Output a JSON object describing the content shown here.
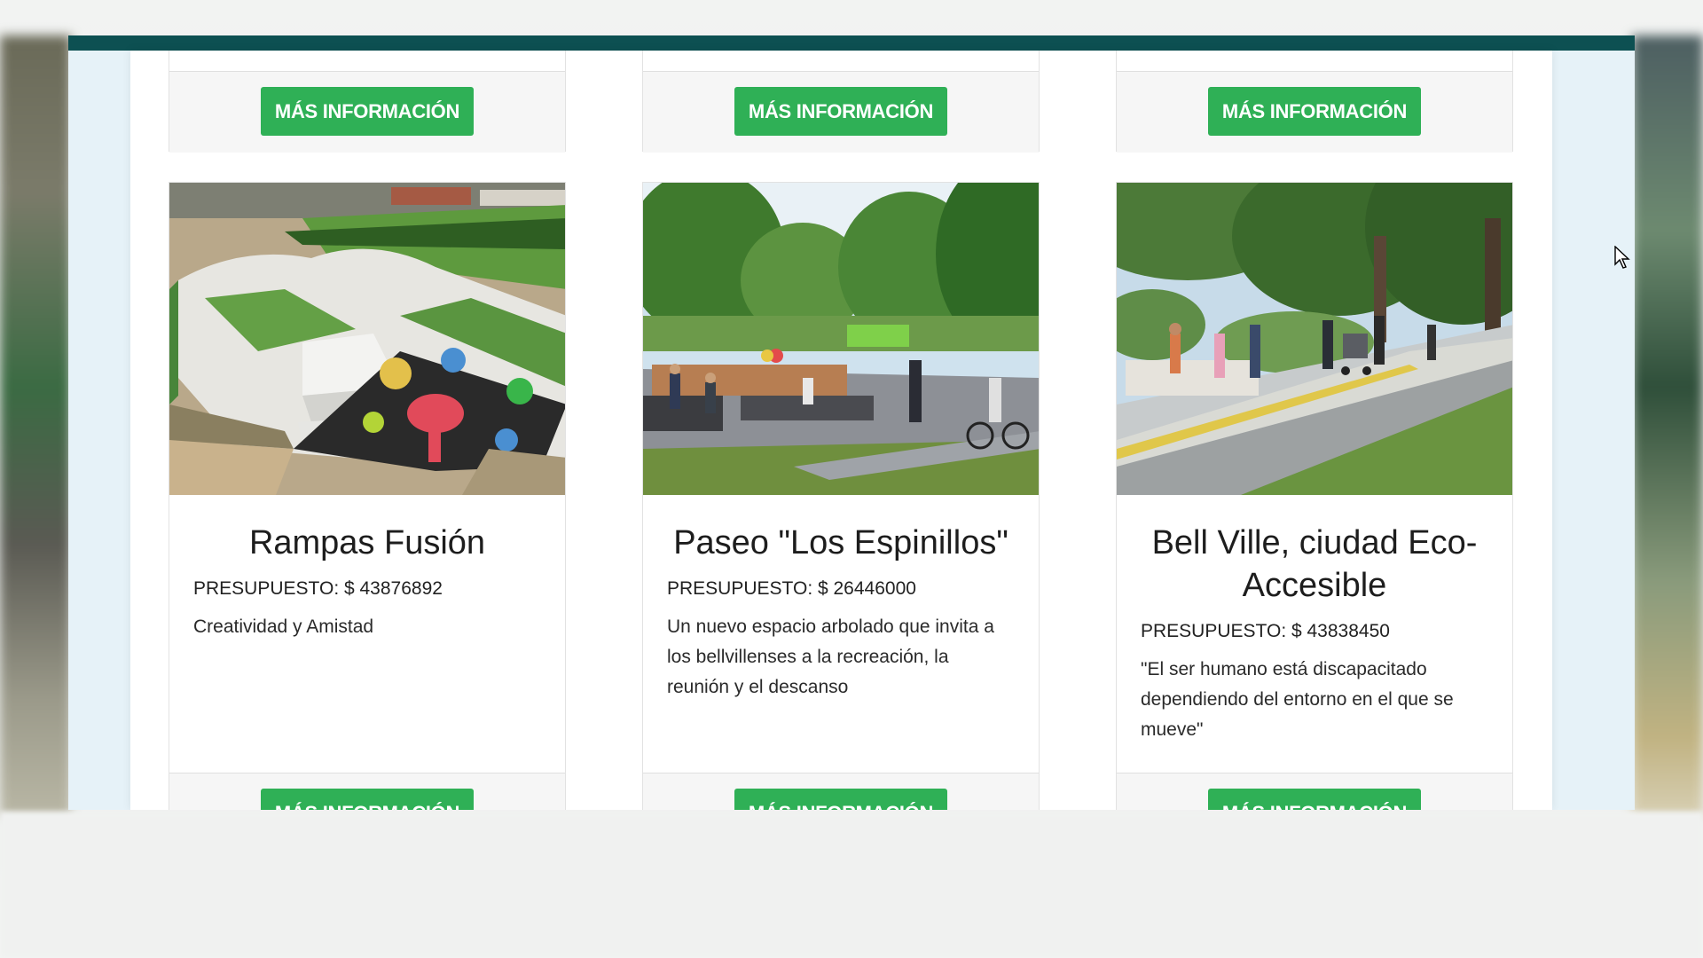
{
  "cards": [
    {
      "title": "Rampas Fusión",
      "budget": "PRESUPUESTO: $ 43876892",
      "description": "Creatividad y Amistad",
      "button": "MÁS INFORMACIÓN",
      "image": "skatepark-photo"
    },
    {
      "title": "Paseo \"Los Espinillos\"",
      "budget": "PRESUPUESTO: $ 26446000",
      "description": "Un nuevo espacio arbolado que invita a los bellvillenses a la recreación, la reunión y el descanso",
      "button": "MÁS INFORMACIÓN",
      "image": "park-promenade-photo"
    },
    {
      "title": "Bell Ville, ciudad Eco-Accesible",
      "budget": "PRESUPUESTO: $ 43838450",
      "description": "\"El ser humano está discapacitado dependiendo del entorno en el que se mueve\"",
      "button": "MÁS INFORMACIÓN",
      "image": "accessible-path-photo"
    }
  ],
  "previous_row_button": "MÁS INFORMACIÓN",
  "colors": {
    "header_bar": "#0d5052",
    "button_green": "#2fb056",
    "window_background": "#e6f2f8"
  }
}
